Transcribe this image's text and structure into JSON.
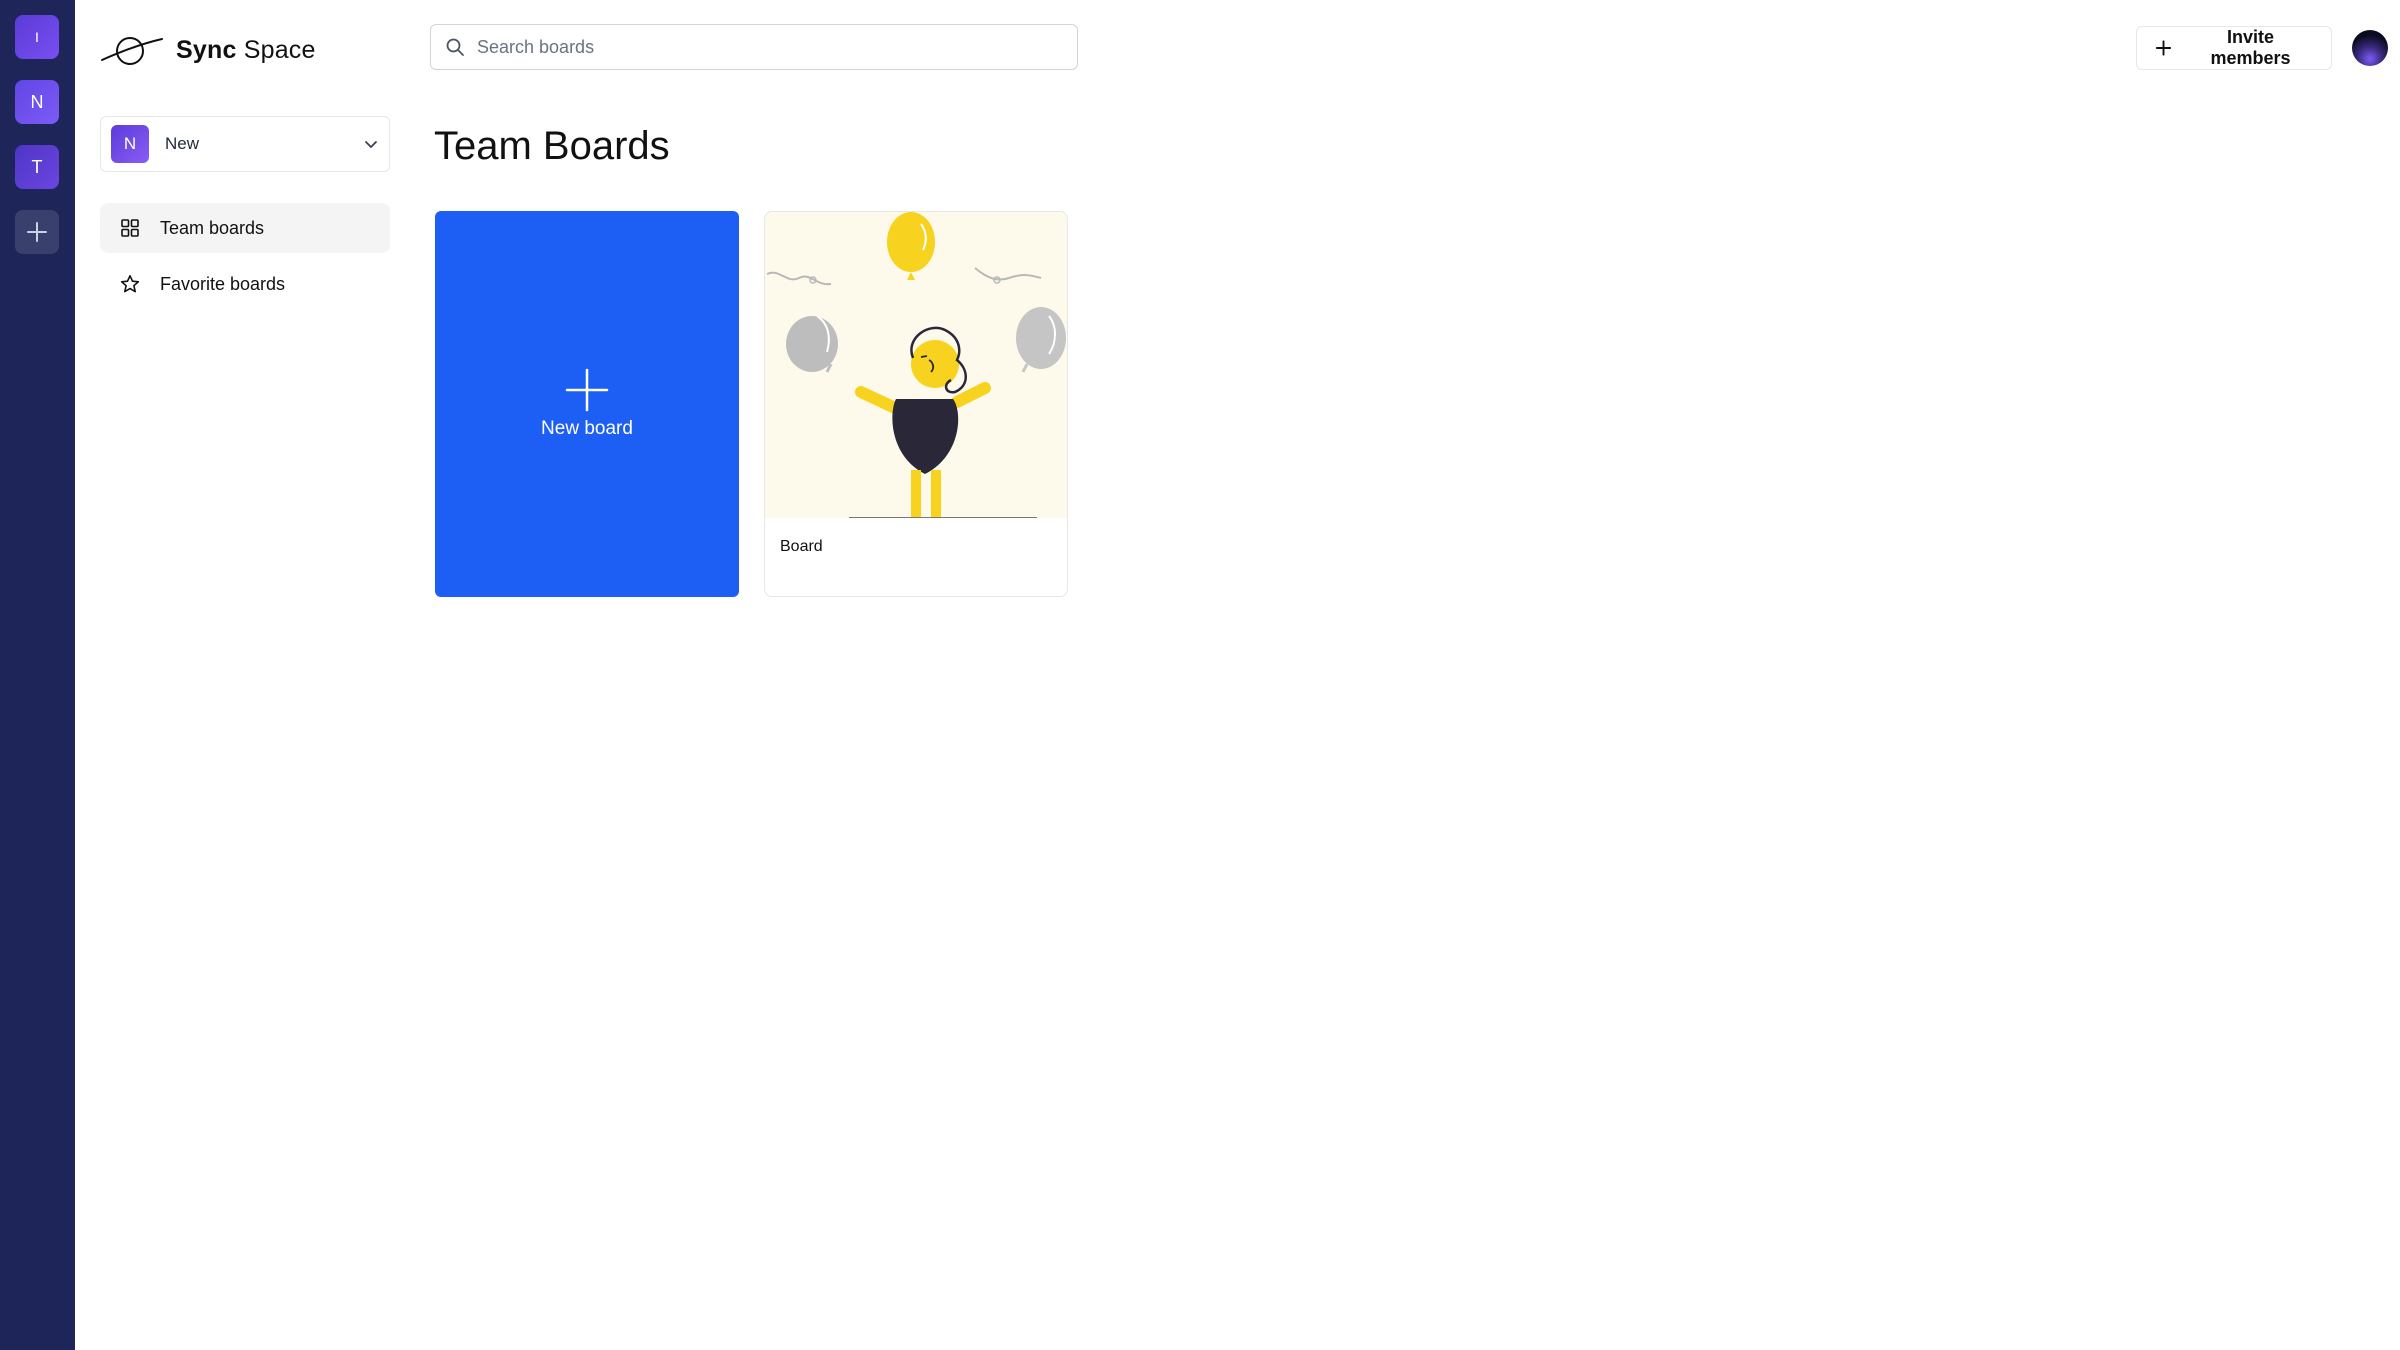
{
  "orgs": [
    "I",
    "N",
    "T"
  ],
  "app": {
    "name_bold": "Sync",
    "name_regular": "Space"
  },
  "org_select": {
    "initial": "N",
    "name": "New"
  },
  "nav": {
    "team_boards": "Team boards",
    "favorite_boards": "Favorite boards"
  },
  "search": {
    "placeholder": "Search boards"
  },
  "header": {
    "invite_label": "Invite members"
  },
  "main": {
    "title": "Team Boards",
    "new_board_label": "New board",
    "boards": [
      {
        "title": "Board"
      }
    ]
  },
  "colors": {
    "rail": "#1e2659",
    "primary": "#1d5ff5",
    "org_purple": "#6245e6"
  },
  "icons": [
    "plus-icon",
    "chevron-down-icon",
    "search-icon",
    "grid-icon",
    "star-icon",
    "logo-icon"
  ]
}
